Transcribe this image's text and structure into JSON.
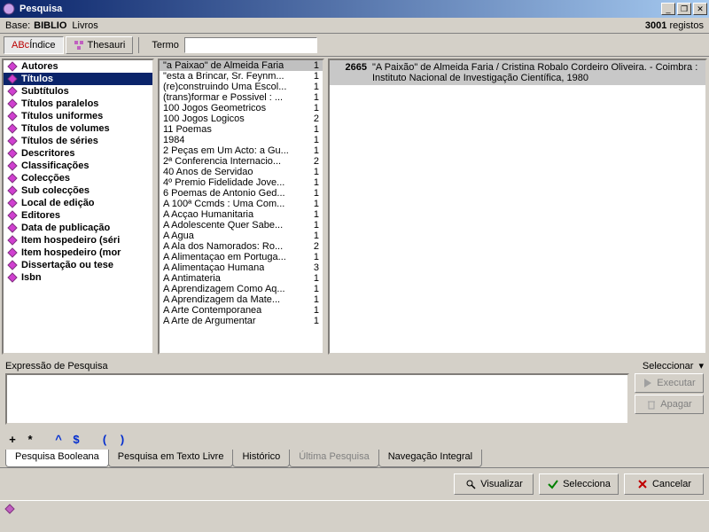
{
  "window": {
    "title": "Pesquisa"
  },
  "base_bar": {
    "label": "Base:",
    "db": "BIBLIO",
    "sub": "Livros",
    "count": "3001",
    "count_label": "registos"
  },
  "toolbar": {
    "indice": {
      "prefix": "ABc",
      "label": "Índice"
    },
    "thesauri": "Thesauri",
    "termo_label": "Termo"
  },
  "indices": [
    "Autores",
    "Títulos",
    "Subtítulos",
    "Títulos paralelos",
    "Títulos uniformes",
    "Títulos de volumes",
    "Títulos de séries",
    "Descritores",
    "Classificações",
    "Colecções",
    "Sub colecções",
    "Local de edição",
    "Editores",
    "Data de publicação",
    "Item hospedeiro (séri",
    "Item hospedeiro (mor",
    "Dissertação ou tese",
    "Isbn"
  ],
  "indices_selected": 1,
  "terms": [
    {
      "t": "\"a Paixao\" de Almeida Faria",
      "c": 1,
      "sel": true
    },
    {
      "t": "\"esta a Brincar, Sr. Feynm...",
      "c": 1
    },
    {
      "t": "(re)construindo Uma Escol...",
      "c": 1
    },
    {
      "t": "(trans)formar e Possivel : ...",
      "c": 1
    },
    {
      "t": "100 Jogos Geometricos",
      "c": 1
    },
    {
      "t": "100 Jogos Logicos",
      "c": 2
    },
    {
      "t": "11 Poemas",
      "c": 1
    },
    {
      "t": "1984",
      "c": 1
    },
    {
      "t": "2 Peças em Um Acto: a Gu...",
      "c": 1
    },
    {
      "t": "2ª Conferencia Internacio...",
      "c": 2
    },
    {
      "t": "40 Anos de Servidao",
      "c": 1
    },
    {
      "t": "4º Premio Fidelidade Jove...",
      "c": 1
    },
    {
      "t": "6 Poemas de Antonio Ged...",
      "c": 1
    },
    {
      "t": "A 100ª Ccmds : Uma Com...",
      "c": 1
    },
    {
      "t": "A Acçao Humanitaria",
      "c": 1
    },
    {
      "t": "A Adolescente Quer Sabe...",
      "c": 1
    },
    {
      "t": "A Agua",
      "c": 1
    },
    {
      "t": "A Ala dos Namorados: Ro...",
      "c": 2
    },
    {
      "t": "A Alimentaçao em Portuga...",
      "c": 1
    },
    {
      "t": "A Alimentaçao Humana",
      "c": 3
    },
    {
      "t": "A Antimateria",
      "c": 1
    },
    {
      "t": "A Aprendizagem Como Aq...",
      "c": 1
    },
    {
      "t": "A Aprendizagem da Mate...",
      "c": 1
    },
    {
      "t": "A Arte Contemporanea",
      "c": 1
    },
    {
      "t": "A Arte de Argumentar",
      "c": 1
    }
  ],
  "record": {
    "num": "2665",
    "text": "\"A Paixão\" de Almeida Faria / Cristina Robalo Cordeiro Oliveira. - Coimbra : Instituto Nacional de Investigação Científica, 1980"
  },
  "expr": {
    "label": "Expressão de Pesquisa",
    "select": "Seleccionar",
    "exec": "Executar",
    "del": "Apagar"
  },
  "ops": [
    "+",
    "*",
    "^",
    "$",
    "(",
    ")"
  ],
  "tabs": [
    {
      "l": "Pesquisa Booleana",
      "active": true
    },
    {
      "l": "Pesquisa em Texto Livre"
    },
    {
      "l": "Histórico"
    },
    {
      "l": "Última Pesquisa",
      "disabled": true
    },
    {
      "l": "Navegação Integral"
    }
  ],
  "actions": {
    "view": "Visualizar",
    "select": "Selecciona",
    "cancel": "Cancelar"
  }
}
